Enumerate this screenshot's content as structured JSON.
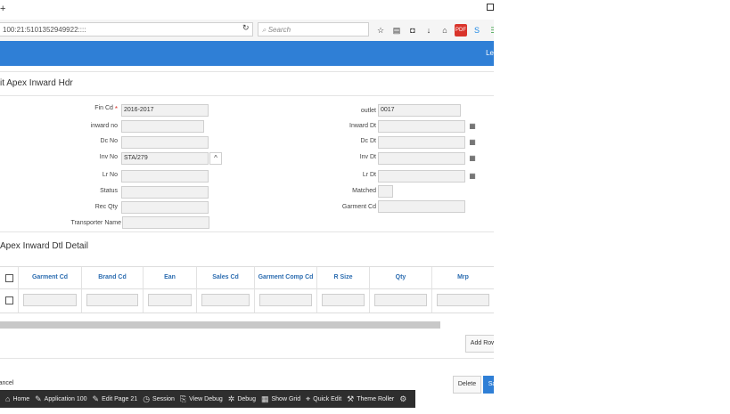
{
  "browser": {
    "url": "100:21:5101352949922::::",
    "search_placeholder": "Search",
    "plus_glyph": "+",
    "reload_icon": "↻",
    "search_icon": "⌕",
    "toolbar_icons": [
      {
        "name": "star-icon",
        "glyph": "☆"
      },
      {
        "name": "reading-list-icon",
        "glyph": "▤"
      },
      {
        "name": "pocket-icon",
        "glyph": "◘"
      },
      {
        "name": "download-icon",
        "glyph": "↓"
      },
      {
        "name": "home-icon",
        "glyph": "⌂"
      },
      {
        "name": "pdf-icon",
        "glyph": "PDF"
      },
      {
        "name": "skype-icon",
        "glyph": "S"
      },
      {
        "name": "extension-icon",
        "glyph": "∃"
      }
    ]
  },
  "apex_bar": {
    "user_fragment": "Le"
  },
  "header_region": {
    "title": "it Apex Inward Hdr",
    "fields_left": [
      {
        "label": "Fin Cd",
        "value": "2016-2017",
        "required": "*"
      },
      {
        "label": "inward no",
        "value": ""
      },
      {
        "label": "Dc No",
        "value": ""
      },
      {
        "label": "Inv No",
        "value": "STA/279",
        "button_glyph": "^"
      },
      {
        "label": "Lr No",
        "value": ""
      },
      {
        "label": "Status",
        "value": ""
      },
      {
        "label": "Rec Qty",
        "value": ""
      },
      {
        "label": "Transporter Name",
        "value": ""
      }
    ],
    "fields_right": [
      {
        "label": "outlet",
        "value": "0017"
      },
      {
        "label": "Inward Dt",
        "value": "",
        "calendar": "▦"
      },
      {
        "label": "Dc Dt",
        "value": "",
        "calendar": "▦"
      },
      {
        "label": "Inv Dt",
        "value": "",
        "calendar": "▦"
      },
      {
        "label": "Lr Dt",
        "value": "",
        "calendar": "▦"
      },
      {
        "label": "Matched",
        "value": ""
      },
      {
        "label": "Garment Cd",
        "value": ""
      }
    ]
  },
  "detail_region": {
    "title": "Apex Inward Dtl Detail",
    "columns": [
      "Garment Cd",
      "Brand Cd",
      "Ean",
      "Sales Cd",
      "Garment Comp Cd",
      "R Size",
      "Qty",
      "Mrp"
    ],
    "add_row_label": "Add Row"
  },
  "actions": {
    "cancel_label": "ancel",
    "delete_label": "Delete",
    "save_label": "Sa"
  },
  "dev_toolbar": [
    {
      "name": "home",
      "icon": "⌂",
      "label": "Home"
    },
    {
      "name": "application",
      "icon": "✎",
      "label": "Application 100"
    },
    {
      "name": "edit-page",
      "icon": "✎",
      "label": "Edit Page 21"
    },
    {
      "name": "session",
      "icon": "◷",
      "label": "Session"
    },
    {
      "name": "view-debug",
      "icon": "⎘",
      "label": "View Debug"
    },
    {
      "name": "debug",
      "icon": "✲",
      "label": "Debug"
    },
    {
      "name": "show-grid",
      "icon": "▦",
      "label": "Show Grid"
    },
    {
      "name": "quick-edit",
      "icon": "⌖",
      "label": "Quick Edit"
    },
    {
      "name": "theme-roller",
      "icon": "⚒",
      "label": "Theme Roller"
    },
    {
      "name": "settings",
      "icon": "⚙",
      "label": ""
    }
  ]
}
